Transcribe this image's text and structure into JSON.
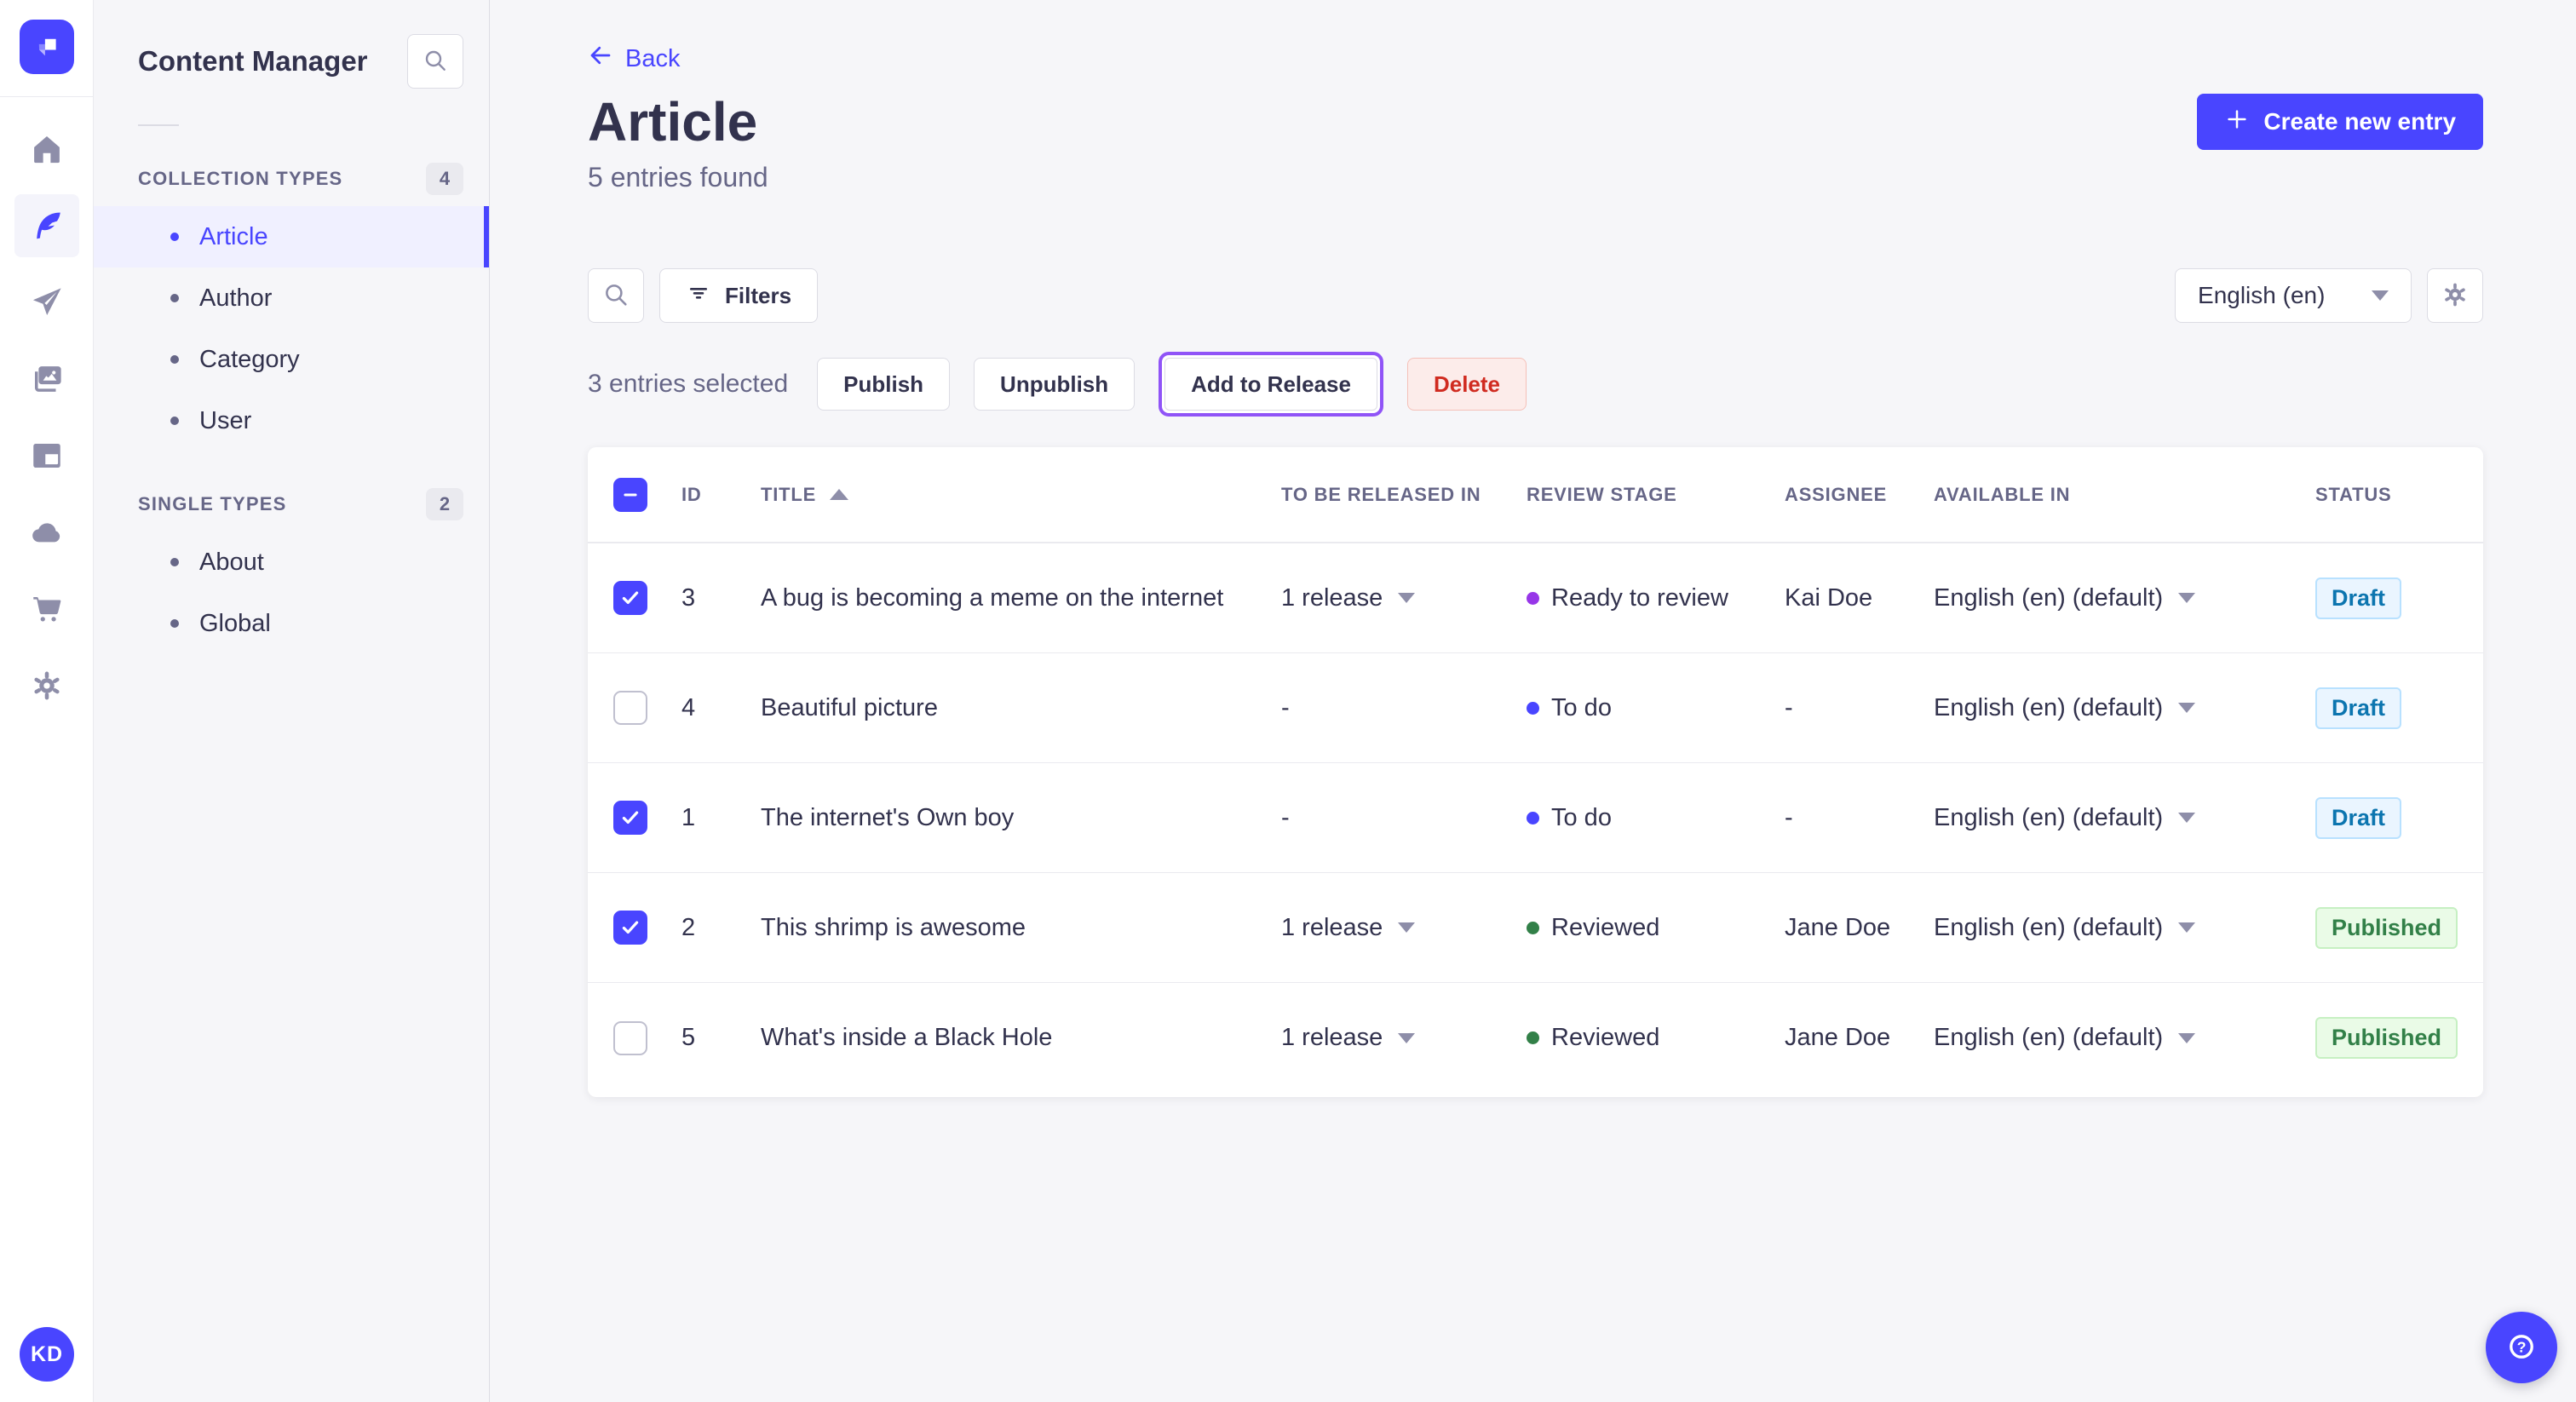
{
  "sidebar": {
    "title": "Content Manager",
    "sections": [
      {
        "label": "COLLECTION TYPES",
        "count": "4",
        "items": [
          {
            "label": "Article",
            "active": true
          },
          {
            "label": "Author",
            "active": false
          },
          {
            "label": "Category",
            "active": false
          },
          {
            "label": "User",
            "active": false
          }
        ]
      },
      {
        "label": "SINGLE TYPES",
        "count": "2",
        "items": [
          {
            "label": "About",
            "active": false
          },
          {
            "label": "Global",
            "active": false
          }
        ]
      }
    ]
  },
  "rail": {
    "user_initials": "KD"
  },
  "header": {
    "back": "Back",
    "title": "Article",
    "subtitle": "5 entries found",
    "create": "Create new entry"
  },
  "toolbar": {
    "filters": "Filters",
    "locale": "English (en)"
  },
  "selection": {
    "summary": "3 entries selected",
    "publish": "Publish",
    "unpublish": "Unpublish",
    "add_to_release": "Add to Release",
    "delete": "Delete"
  },
  "table": {
    "columns": [
      "ID",
      "TITLE",
      "TO BE RELEASED IN",
      "REVIEW STAGE",
      "ASSIGNEE",
      "AVAILABLE IN",
      "STATUS"
    ],
    "sorted_column": "TITLE",
    "sort_direction": "asc",
    "rows": [
      {
        "selected": true,
        "id": "3",
        "title": "A bug is becoming a meme on the internet",
        "release": "1 release",
        "stage": "Ready to review",
        "stage_color": "#9736e8",
        "assignee": "Kai Doe",
        "locale": "English (en) (default)",
        "status": "Draft"
      },
      {
        "selected": false,
        "id": "4",
        "title": "Beautiful picture",
        "release": "-",
        "stage": "To do",
        "stage_color": "#4945ff",
        "assignee": "-",
        "locale": "English (en) (default)",
        "status": "Draft"
      },
      {
        "selected": true,
        "id": "1",
        "title": "The internet's Own boy",
        "release": "-",
        "stage": "To do",
        "stage_color": "#4945ff",
        "assignee": "-",
        "locale": "English (en) (default)",
        "status": "Draft"
      },
      {
        "selected": true,
        "id": "2",
        "title": "This shrimp is awesome",
        "release": "1 release",
        "stage": "Reviewed",
        "stage_color": "#328048",
        "assignee": "Jane Doe",
        "locale": "English (en) (default)",
        "status": "Published"
      },
      {
        "selected": false,
        "id": "5",
        "title": "What's inside a Black Hole",
        "release": "1 release",
        "stage": "Reviewed",
        "stage_color": "#328048",
        "assignee": "Jane Doe",
        "locale": "English (en) (default)",
        "status": "Published"
      }
    ]
  },
  "colors": {
    "primary": "#4945ff",
    "release_highlight": "#9054f7",
    "danger": "#d02b20",
    "stage_todo": "#4945ff",
    "stage_ready_to_review": "#9736e8",
    "stage_reviewed": "#328048",
    "status_draft_text": "#0c75af",
    "status_published_text": "#328048"
  }
}
